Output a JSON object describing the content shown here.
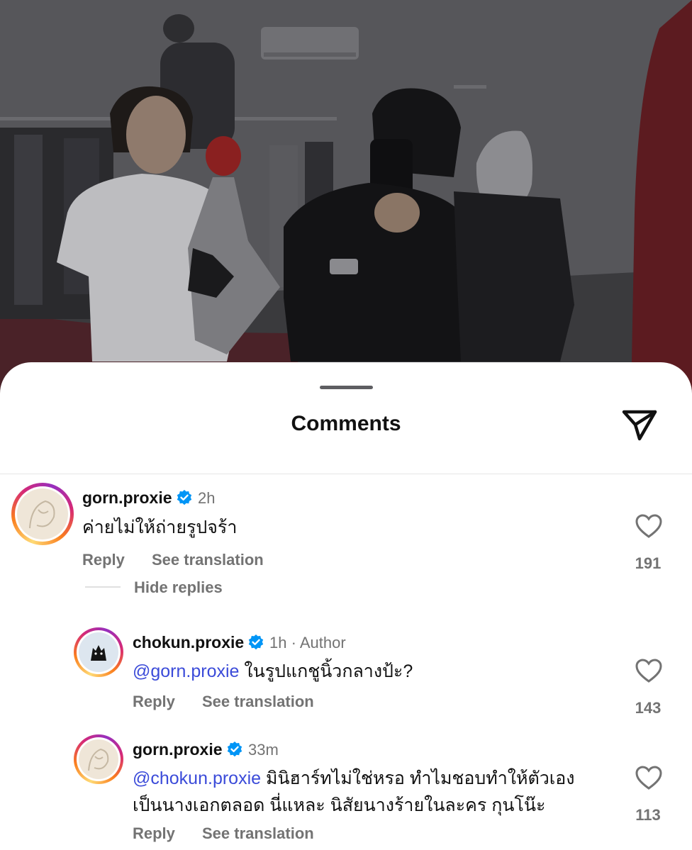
{
  "sheet": {
    "title": "Comments",
    "share_icon": "paper-plane-icon"
  },
  "comments": [
    {
      "username": "gorn.proxie",
      "verified": true,
      "time": "2h",
      "text": "ค่ายไม่ให้ถ่ายรูปจร้า",
      "reply_label": "Reply",
      "translate_label": "See translation",
      "likes": "191",
      "hide_replies_label": "Hide replies",
      "replies": [
        {
          "username": "chokun.proxie",
          "verified": true,
          "time": "1h",
          "separator": "·",
          "badge": "Author",
          "mention": "@gorn.proxie",
          "text": "ในรูปแกชูนิ้วกลางป้ะ?",
          "reply_label": "Reply",
          "translate_label": "See translation",
          "likes": "143"
        },
        {
          "username": "gorn.proxie",
          "verified": true,
          "time": "33m",
          "mention": "@chokun.proxie",
          "text_line1": "มินิฮาร์ทไม่ใช่หรอ ทำไมชอบทำให้ตัวเอง",
          "text_line2": "เป็นนางเอกตลอด นี่แหละ นิสัยนางร้ายในละคร กุนโน๊ะ",
          "reply_label": "Reply",
          "translate_label": "See translation",
          "likes": "113"
        }
      ]
    }
  ],
  "colors": {
    "mention": "#3b4bd9",
    "verified": "#0095f6",
    "secondary_text": "#737373"
  }
}
